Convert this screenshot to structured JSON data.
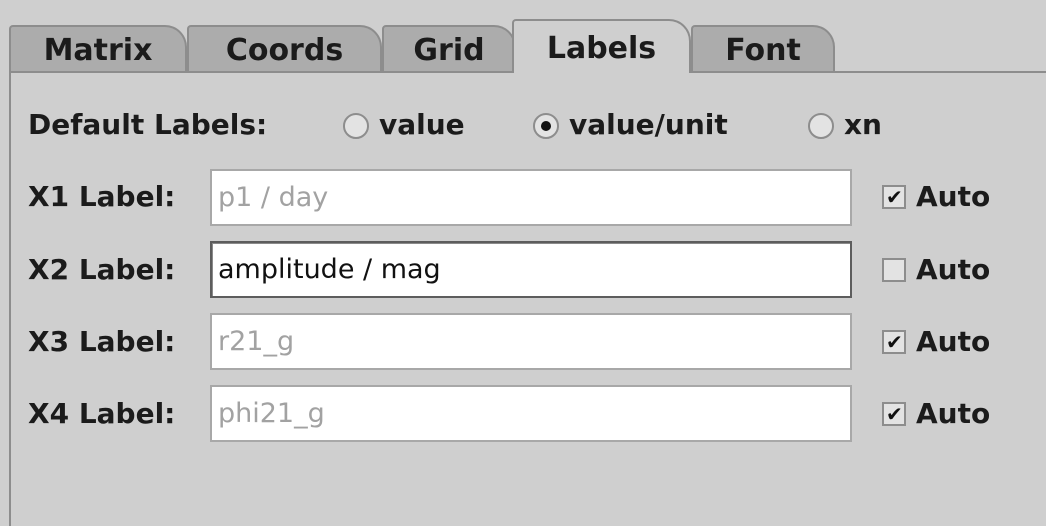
{
  "tabs": [
    {
      "label": "Matrix",
      "active": false
    },
    {
      "label": "Coords",
      "active": false
    },
    {
      "label": "Grid",
      "active": false
    },
    {
      "label": "Labels",
      "active": true
    },
    {
      "label": "Font",
      "active": false
    }
  ],
  "default_labels": {
    "label": "Default Labels:",
    "options": [
      {
        "label": "value",
        "selected": false
      },
      {
        "label": "value/unit",
        "selected": true
      },
      {
        "label": "xn",
        "selected": false
      }
    ]
  },
  "rows": [
    {
      "label": "X1 Label:",
      "value": "p1 / day",
      "enabled": false,
      "auto_label": "Auto",
      "auto_checked": true
    },
    {
      "label": "X2 Label:",
      "value": "amplitude / mag",
      "enabled": true,
      "auto_label": "Auto",
      "auto_checked": false
    },
    {
      "label": "X3 Label:",
      "value": "r21_g",
      "enabled": false,
      "auto_label": "Auto",
      "auto_checked": true
    },
    {
      "label": "X4 Label:",
      "value": "phi21_g",
      "enabled": false,
      "auto_label": "Auto",
      "auto_checked": true
    }
  ],
  "icons": {
    "checkmark": "checkmark-icon",
    "radio_dot": "radio-dot-icon"
  },
  "colors": {
    "background": "#cfcfcf",
    "inactive_tab": "#acacac",
    "border": "#8d8d8d",
    "disabled_text": "#a2a2a2"
  }
}
